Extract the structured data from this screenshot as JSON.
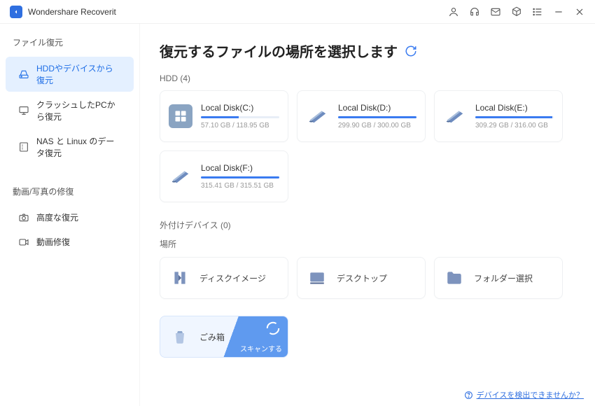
{
  "app": {
    "title": "Wondershare Recoverit"
  },
  "sidebar": {
    "group1_label": "ファイル復元",
    "group2_label": "動画/写真の修復",
    "items": [
      {
        "label": "HDDやデバイスから復元"
      },
      {
        "label": "クラッシュしたPCから復元"
      },
      {
        "label": "NAS と Linux のデータ復元"
      },
      {
        "label": "高度な復元"
      },
      {
        "label": "動画修復"
      }
    ]
  },
  "main": {
    "page_title": "復元するファイルの場所を選択します",
    "hdd_section_label": "HDD (4)",
    "external_section_label": "外付けデバイス (0)",
    "locations_section_label": "場所",
    "trash_label": "ごみ箱",
    "scan_label": "スキャンする",
    "footer_link": "デバイスを検出できませんか？"
  },
  "disks": [
    {
      "name": "Local Disk(C:)",
      "used": 57.1,
      "total": 118.95,
      "size": "57.10 GB / 118.95 GB",
      "color": "#8aa4c2"
    },
    {
      "name": "Local Disk(D:)",
      "used": 299.9,
      "total": 300.0,
      "size": "299.90 GB / 300.00 GB",
      "color": "#6e8cbf"
    },
    {
      "name": "Local Disk(E:)",
      "used": 309.29,
      "total": 316.0,
      "size": "309.29 GB / 316.00 GB",
      "color": "#6e8cbf"
    },
    {
      "name": "Local Disk(F:)",
      "used": 315.41,
      "total": 315.51,
      "size": "315.41 GB / 315.51 GB",
      "color": "#6e8cbf"
    }
  ],
  "locations": [
    {
      "label": "ディスクイメージ"
    },
    {
      "label": "デスクトップ"
    },
    {
      "label": "フォルダー選択"
    }
  ]
}
